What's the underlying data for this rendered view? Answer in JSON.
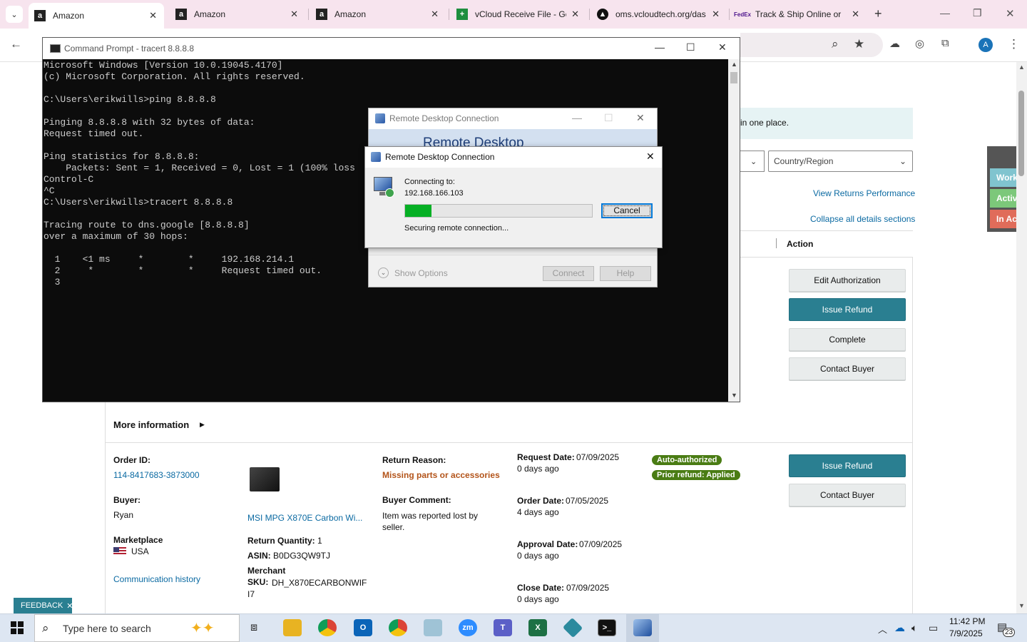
{
  "browser": {
    "tabs": [
      {
        "title": "Amazon",
        "active": true
      },
      {
        "title": "Amazon",
        "active": false
      },
      {
        "title": "Amazon",
        "active": false
      },
      {
        "title": "vCloud Receive File - Gc",
        "active": false
      },
      {
        "title": "oms.vcloudtech.org/das",
        "active": false
      },
      {
        "title": "Track & Ship Online or",
        "active": false
      }
    ],
    "profile_initial": "A"
  },
  "page": {
    "banner_text": "in one place.",
    "country_placeholder": "Country/Region",
    "view_returns_link": "View Returns Performance",
    "collapse_link": "Collapse all details sections",
    "action_header": "Action",
    "actions_top": [
      "Edit Authorization",
      "Issue Refund",
      "Complete",
      "Contact Buyer"
    ],
    "more_info": "More information",
    "order": {
      "order_id_label": "Order ID:",
      "order_id": "114-8417683-3873000",
      "buyer_label": "Buyer:",
      "buyer": "Ryan",
      "marketplace_label": "Marketplace",
      "marketplace": "USA",
      "comm_history": "Communication history",
      "product_name": "MSI MPG X870E Carbon Wi...",
      "return_qty_label": "Return Quantity:",
      "return_qty": "1",
      "asin_label": "ASIN:",
      "asin": "B0DG3QW9TJ",
      "merchant_label": "Merchant",
      "sku_label": "SKU:",
      "sku": "DH_X870ECARBONWIF I7",
      "return_reason_label": "Return Reason:",
      "return_reason": "Missing parts or accessories",
      "buyer_comment_label": "Buyer Comment:",
      "buyer_comment": "Item was reported lost by seller.",
      "request_date_label": "Request Date:",
      "request_date": "07/09/2025",
      "request_ago": "0 days ago",
      "order_date_label": "Order Date:",
      "order_date": "07/05/2025",
      "order_ago": "4 days ago",
      "approval_date_label": "Approval Date:",
      "approval_date": "07/09/2025",
      "approval_ago": "0 days ago",
      "close_date_label": "Close Date:",
      "close_date": "07/09/2025",
      "close_ago": "0 days ago",
      "badges": [
        "Auto-authorized",
        "Prior refund: Applied"
      ],
      "actions": [
        "Issue Refund",
        "Contact Buyer"
      ]
    },
    "side_status": [
      "Workin",
      "Active:",
      "In Activ"
    ],
    "feedback": "FEEDBACK"
  },
  "cmd": {
    "title": "Command Prompt - tracert  8.8.8.8",
    "lines": [
      "Microsoft Windows [Version 10.0.19045.4170]",
      "(c) Microsoft Corporation. All rights reserved.",
      "",
      "C:\\Users\\erikwills>ping 8.8.8.8",
      "",
      "Pinging 8.8.8.8 with 32 bytes of data:",
      "Request timed out.",
      "",
      "Ping statistics for 8.8.8.8:",
      "    Packets: Sent = 1, Received = 0, Lost = 1 (100% loss",
      "Control-C",
      "^C",
      "C:\\Users\\erikwills>tracert 8.8.8.8",
      "",
      "Tracing route to dns.google [8.8.8.8]",
      "over a maximum of 30 hops:",
      "",
      "  1    <1 ms     *        *     192.168.214.1",
      "  2     *        *        *     Request timed out.",
      "  3"
    ]
  },
  "rdp_back": {
    "title": "Remote Desktop Connection",
    "banner": "Remote Desktop",
    "show_options": "Show Options",
    "connect": "Connect",
    "help": "Help"
  },
  "rdp_dialog": {
    "title": "Remote Desktop Connection",
    "connecting_label": "Connecting to:",
    "host": "192.168.166.103",
    "progress": 0.14,
    "status": "Securing remote connection...",
    "cancel": "Cancel"
  },
  "taskbar": {
    "search_placeholder": "Type here to search",
    "time": "11:42 PM",
    "date": "7/9/2025",
    "notifications": "23"
  }
}
